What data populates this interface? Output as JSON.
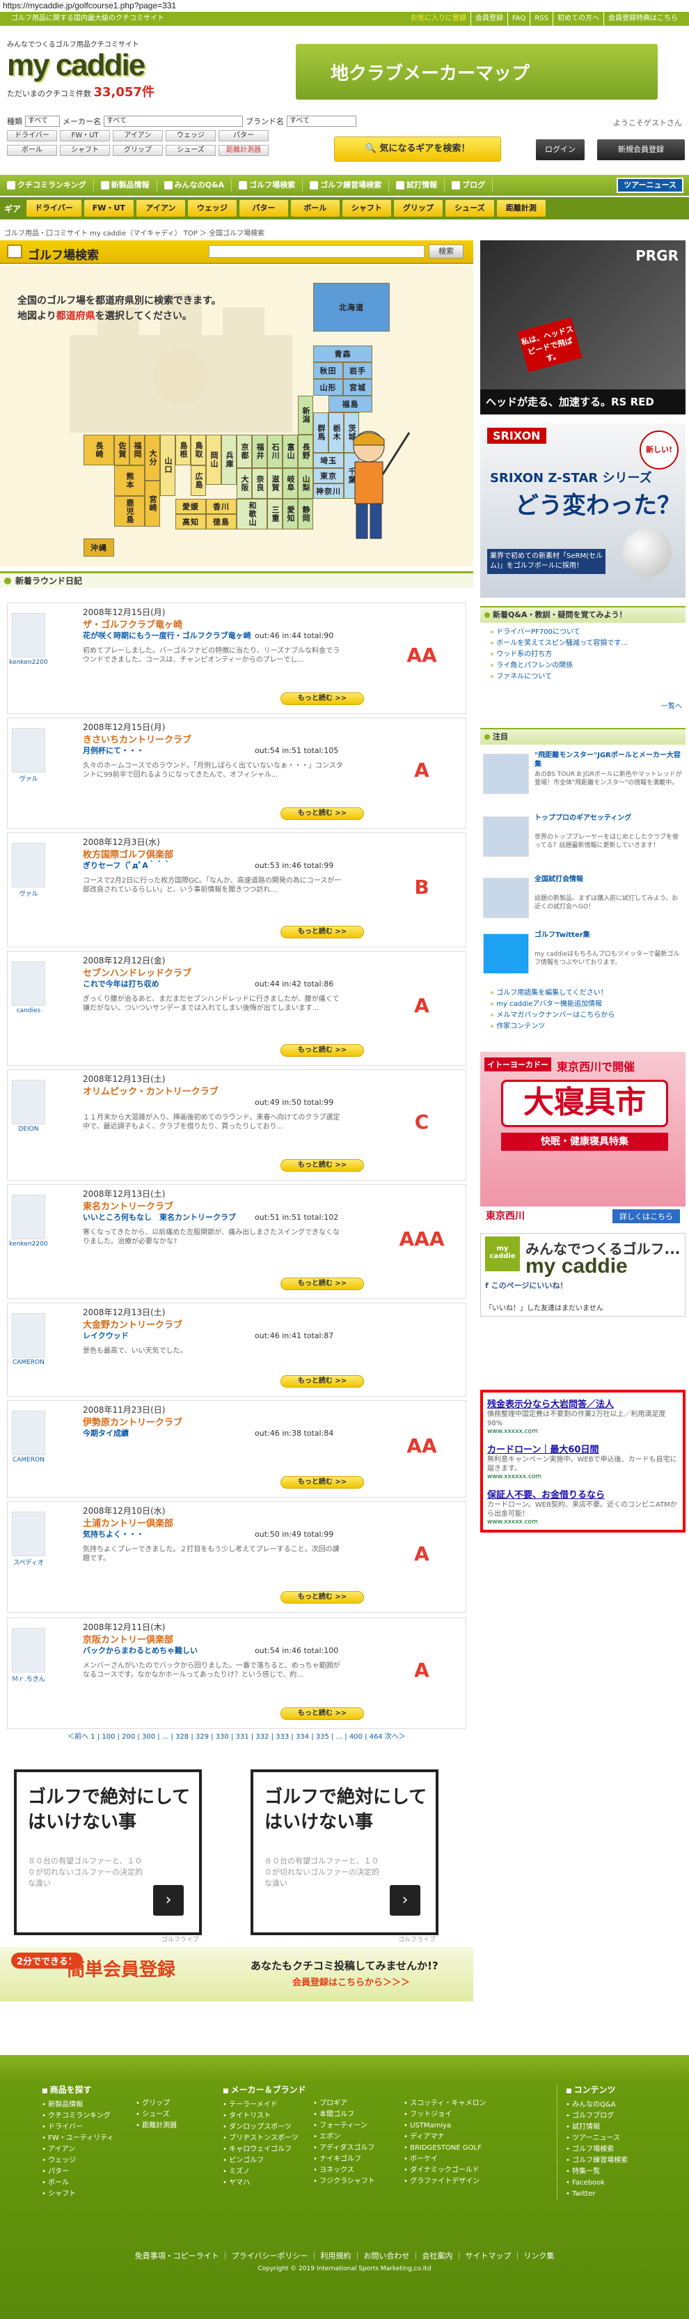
{
  "url": "https://mycaddie.jp/golfcourse1.php?page=331",
  "topbar": {
    "tagline": "ゴルフ用品に関する国内最大級のクチコミサイト",
    "links": [
      "お気に入りに登録",
      "会員登録",
      "FAQ",
      "RSS",
      "初めての方へ",
      "会員登録特典はこちら",
      "ログイン"
    ]
  },
  "logo": {
    "tag": "みんなでつくるゴルフ用品クチコミサイト",
    "name": "my caddie",
    "count_label": "ただいまのクチコミ件数",
    "count": "33,057件"
  },
  "banner": {
    "text": "地クラブメーカーマップ"
  },
  "welcome": "ようこそゲストさん",
  "search": {
    "labels": [
      "種類",
      "メーカー名",
      "ブランド名"
    ],
    "selects": [
      "すべて",
      "すべて",
      "すべて"
    ],
    "row1": [
      "ドライバー",
      "FW・UT",
      "アイアン",
      "ウェッジ",
      "パター"
    ],
    "row2": [
      "ボール",
      "シャフト",
      "グリップ",
      "シューズ",
      "距離計測器"
    ],
    "submit": "気になるギアを検索！"
  },
  "auth": {
    "login": "ログイン",
    "register": "新規会員登録"
  },
  "mainnav": [
    "クチコミランキング",
    "新製品情報",
    "みんなのQ&A",
    "ゴルフ場検索",
    "ゴルフ練習場検索",
    "試打情報",
    "ブログ",
    "ツアーニュース"
  ],
  "gearbar": {
    "label": "ギア",
    "items": [
      "ドライバー",
      "FW・UT",
      "アイアン",
      "ウェッジ",
      "パター",
      "ボール",
      "シャフト",
      "グリップ",
      "シューズ",
      "距離計測"
    ]
  },
  "breadcrumb": "ゴルフ用品・口コミサイト my caddie（マイキャディ） TOP ＞ 全国ゴルフ場検索",
  "golf_search": {
    "title": "ゴルフ場検索",
    "button": "検索",
    "intro1": "全国のゴルフ場を都道府県別に検索できます。",
    "intro2a": "地図より",
    "intro2hl": "都道府県",
    "intro2b": "を選択してください。"
  },
  "prefectures": {
    "hokkaido": "北海道",
    "aomori": "青森",
    "akita": "秋田",
    "iwate": "岩手",
    "yamagata": "山形",
    "miyagi": "宮城",
    "fukushima": "福島",
    "ibaraki": "茨城",
    "tochigi": "栃木",
    "gunma": "群馬",
    "saitama": "埼玉",
    "chiba": "千葉",
    "tokyo": "東京",
    "kanagawa": "神奈川",
    "niigata": "新潟",
    "toyama": "富山",
    "ishikawa": "石川",
    "fukui": "福井",
    "yamanashi": "山梨",
    "nagano": "長野",
    "gifu": "岐阜",
    "shizuoka": "静岡",
    "aichi": "愛知",
    "mie": "三重",
    "shiga": "滋賀",
    "kyoto": "京都",
    "osaka": "大阪",
    "hyogo": "兵庫",
    "nara": "奈良",
    "wakayama": "和歌山",
    "tottori": "鳥取",
    "shimane": "島根",
    "okayama": "岡山",
    "hiroshima": "広島",
    "yamaguchi": "山口",
    "tokushima": "徳島",
    "kagawa": "香川",
    "ehime": "愛媛",
    "kochi": "高知",
    "fukuoka": "福岡",
    "saga": "佐賀",
    "nagasaki": "長崎",
    "kumamoto": "熊本",
    "oita": "大分",
    "miyazaki": "宮崎",
    "kagoshima": "鹿児島",
    "okinawa": "沖縄"
  },
  "diary": {
    "title": "新着ラウンド日記",
    "more": "もっと読む >>",
    "entries": [
      {
        "date": "2008年12月15日(月)",
        "course": "ザ・ゴルフクラブ竜ヶ崎",
        "title": "花が咲く時期にもう一度行・ゴルフクラブ竜ヶ崎",
        "score": "out:46 in:44 total:90",
        "body": "初めてプレーしました。バーゴルフナビの特徴に当たり、リーズナブルな料金でラウンドできました。コースは、チャンピオンティーからのプレーでし...",
        "user": "kenken2200",
        "rank": "AA"
      },
      {
        "date": "2008年12月15日(月)",
        "course": "きさいちカントリークラブ",
        "title": "月例杯にて・・・",
        "score": "out:54 in:51 total:105",
        "body": "久々のホームコースでのラウンド。「月例しばらく出ていないなぁ・・・」コンスタントに99前半で回れるようになってきたんで、オフィシャル...",
        "user": "ヴァル",
        "rank": "A"
      },
      {
        "date": "2008年12月3日(水)",
        "course": "枚方国際ゴルフ倶楽部",
        "title": "ぎりセーフ（ﾟдﾟA｀｀｀",
        "score": "out:53 in:46 total:99",
        "body": "コースで2月2日に行った枚方国際GC。「なんか、高速道路の開発の為にコースが一部改良されているらしい」と、いう事前情報を聞きつつ訪れ...",
        "user": "ヴァル",
        "rank": "B"
      },
      {
        "date": "2008年12月12日(金)",
        "course": "セブンハンドレッドクラブ",
        "title": "これで今年は打ち収め",
        "score": "out:44 in:42 total:86",
        "body": "ぎっくり腰が治るあと、まだまだセブンハンドレッドに行きましたが、腰が痛くて嫌だがない。ついついサンデーまでは入れてしまい後悔が出てしまいます...",
        "user": "candies",
        "rank": "A"
      },
      {
        "date": "2008年12月13日(土)",
        "course": "オリムピック・カントリークラブ",
        "title": "",
        "score": "out:49 in:50 total:99",
        "body": "１１月末から大混雑が入り、挿画後初めてのラウンド。来春へ向けてのクラブ選定中で、最近調子もよく、クラブを借りたり、買ったりしており...",
        "user": "DEION",
        "rank": "C"
      },
      {
        "date": "2008年12月13日(土)",
        "course": "東名カントリークラブ",
        "title": "いいところ何もなし　東名カントリークラブ",
        "score": "out:51 in:51 total:102",
        "body": "寒くなってきたから、以前痛めた左股関節が、痛み出しまさたスイングできなくなりました。治療が必要なかな?",
        "user": "kenken2200",
        "rank": "AAA"
      },
      {
        "date": "2008年12月13日(土)",
        "course": "大金野カントリークラブ",
        "title": "レイクウッド",
        "score": "out:46 in:41 total:87",
        "body": "景色も最高で、いい天気でした。",
        "user": "CAMERON",
        "rank": ""
      },
      {
        "date": "2008年11月23日(日)",
        "course": "伊勢原カントリークラブ",
        "title": "今期タイ成績",
        "score": "out:46 in:38 total:84",
        "body": "",
        "user": "CAMERON",
        "rank": "AA"
      },
      {
        "date": "2008年12月10日(水)",
        "course": "土浦カントリー倶楽部",
        "title": "気持ちよく・・・",
        "score": "out:50 in:49 total:99",
        "body": "気持ちよくプレーできました。２打目をもう少し考えてプレーすること。次回の課題です。",
        "user": "スペディオ",
        "rank": "A"
      },
      {
        "date": "2008年12月11日(木)",
        "course": "京阪カントリー倶楽部",
        "title": "バックからまわるとめちゃ難しい",
        "score": "out:54 in:46 total:100",
        "body": "メンバーさんがいたのでバックから回りました。一番で落ちると、めっちゃ範囲がなるコースです。なかなかホールってあったりけ？という感じで、約...",
        "user": "Ｍｒ.ちきん",
        "rank": "A"
      }
    ]
  },
  "pager": "＜前へ 1 | 100 | 200 | 300 | ... | 328 | 329 | 330 | 331 | 332 | 333 | 334 | 335 | ... | 400 | 464 次へ＞",
  "ads": [
    {
      "big": "ゴルフで絶対にしてはいけない事",
      "small": "８０台の有望ゴルファーと、１００が切れないゴルファーの決定的な違い",
      "attr": "ゴルフライブ"
    },
    {
      "big": "ゴルフで絶対にしてはいけない事",
      "small": "８０台の有望ゴルファーと、１００が切れないゴルファーの決定的な違い",
      "attr": "ゴルフライブ"
    }
  ],
  "member": {
    "badge": "2分でできる！",
    "title": "簡単会員登録",
    "q": "あなたもクチコミ投稿してみませんか!?",
    "link": "会員登録はこちらから＞＞＞"
  },
  "sidebar": {
    "prgr": {
      "logo": "PRGR",
      "tag": "私は、ヘッドスピードで飛ばす。",
      "bottom": "ヘッドが走る、加速する。RS RED"
    },
    "srixon": {
      "logo": "SRIXON",
      "new": "新しい!",
      "t1": "SRIXON Z-STAR シリーズ",
      "t2": "どう変わった？",
      "t3": "業界で初めての新素材「SeRM(セルム)」をゴルフボールに採用！"
    },
    "news_head": "新着Q&A・教訓・疑問を覚てみよう！",
    "news": [
      "ドライバーPF700について",
      "ボールを笑えてスピン騒減って容損です...",
      "ウッド系の打ち方",
      "ライ角とパフレンの関係",
      "ファネルについて"
    ],
    "news_more": "一覧へ",
    "pick_head": "注目",
    "features": [
      {
        "h": "\"飛距離モンスター\"JGRボールとメーカー大容集",
        "d": "あのBS TOUR B JGRボールに新色やマットレッドが登場！市全体\"飛距離モンスター\"の情報を満載中。"
      },
      {
        "h": "トッププロのギアセッティング",
        "d": "世界のトッププレーヤーをはじめとしたクラブを使ってる？話題最新情報に更新していきます！"
      },
      {
        "h": "全国試打会情報",
        "d": "話題の新製品、まずは購入前に試打してみよう。お近くの試打会へGO！"
      },
      {
        "h": "ゴルフTwitter集",
        "d": "my caddieはもちろんプロもツイッターで最新ゴルフ情報をつぶやいております。"
      }
    ],
    "links": [
      "ゴルフ用語集を編集してください！",
      "my caddieアバター機能追加情報",
      "メルマガバックナンバーはこちらから",
      "作家コンテンツ"
    ],
    "tokyu": {
      "logo": "イトーヨーカドー",
      "t1": "東京西川で開催",
      "t2": "大寝具市",
      "t3": "快眠・健康寝具特集",
      "t4": "東京西川",
      "more": "詳しくはこちら"
    },
    "fb": {
      "t1": "みんなでつくるゴルフ...",
      "t2": "my caddie",
      "like": "このページにいいね！",
      "none": "「いいね！」した友達はまだいません"
    },
    "adsense": [
      {
        "h": "残金表示分なら大岩問答／法人",
        "d": "債務整理中国定費は不要割の作業2万社以上／利用満足度98%",
        "u": "www.xxxxx.com"
      },
      {
        "h": "カードローン｜最大60日間",
        "d": "無利息キャンペーン実施中。WEBで申込後、カードも自宅に届きます。",
        "u": "www.xxxxxx.com"
      },
      {
        "h": "保証人不要、お金借りるなら",
        "d": "カードローン。WEB契約、来店不要。近くのコンビニATMから出金可能！",
        "u": "www.xxxxx.com"
      }
    ]
  },
  "footer": {
    "col1": {
      "head": "商品を探す",
      "items": [
        "新製品情報",
        "クチコミランキング",
        "ドライバー",
        "FW・ユーティリティ",
        "アイアン",
        "ウェッジ",
        "パター",
        "ボール",
        "シャフト"
      ]
    },
    "col2": {
      "items": [
        "グリップ",
        "シューズ",
        "距離計測器"
      ]
    },
    "col3": {
      "head": "メーカー＆ブランド",
      "items": [
        "テーラーメイド",
        "タイトリスト",
        "ダンロップスポーツ",
        "ブリヂストンスポーツ",
        "キャロウェイゴルフ",
        "ピンゴルフ",
        "ミズノ",
        "ヤマハ"
      ]
    },
    "col4": {
      "items": [
        "プロギア",
        "本間ゴルフ",
        "フォーティーン",
        "エポン",
        "アディダスゴルフ",
        "ナイキゴルフ",
        "ヨネックス",
        "フジクラシャフト"
      ]
    },
    "col5": {
      "items": [
        "スコッティ・キャメロン",
        "フットジョイ",
        "USTMamiya",
        "ディアマナ",
        "BRIDGESTONE GOLF",
        "ボーケイ",
        "ダイナミックゴールド",
        "グラファイトデザイン"
      ]
    },
    "col6": {
      "head": "コンテンツ",
      "items": [
        "みんなのQ&A",
        "ゴルフブログ",
        "試打情報",
        "ツアーニュース",
        "ゴルフ場検索",
        "ゴルフ練習場検索",
        "特集一覧",
        "Facebook",
        "Twitter"
      ]
    },
    "links": "免責事項・コピーライト ｜ プライバシーポリシー ｜ 利用規約 ｜ お問い合わせ ｜ 会社案内 ｜ サイトマップ ｜ リンク集",
    "copy": "Copyright © 2019 International Sports Marketing,co.ltd"
  }
}
